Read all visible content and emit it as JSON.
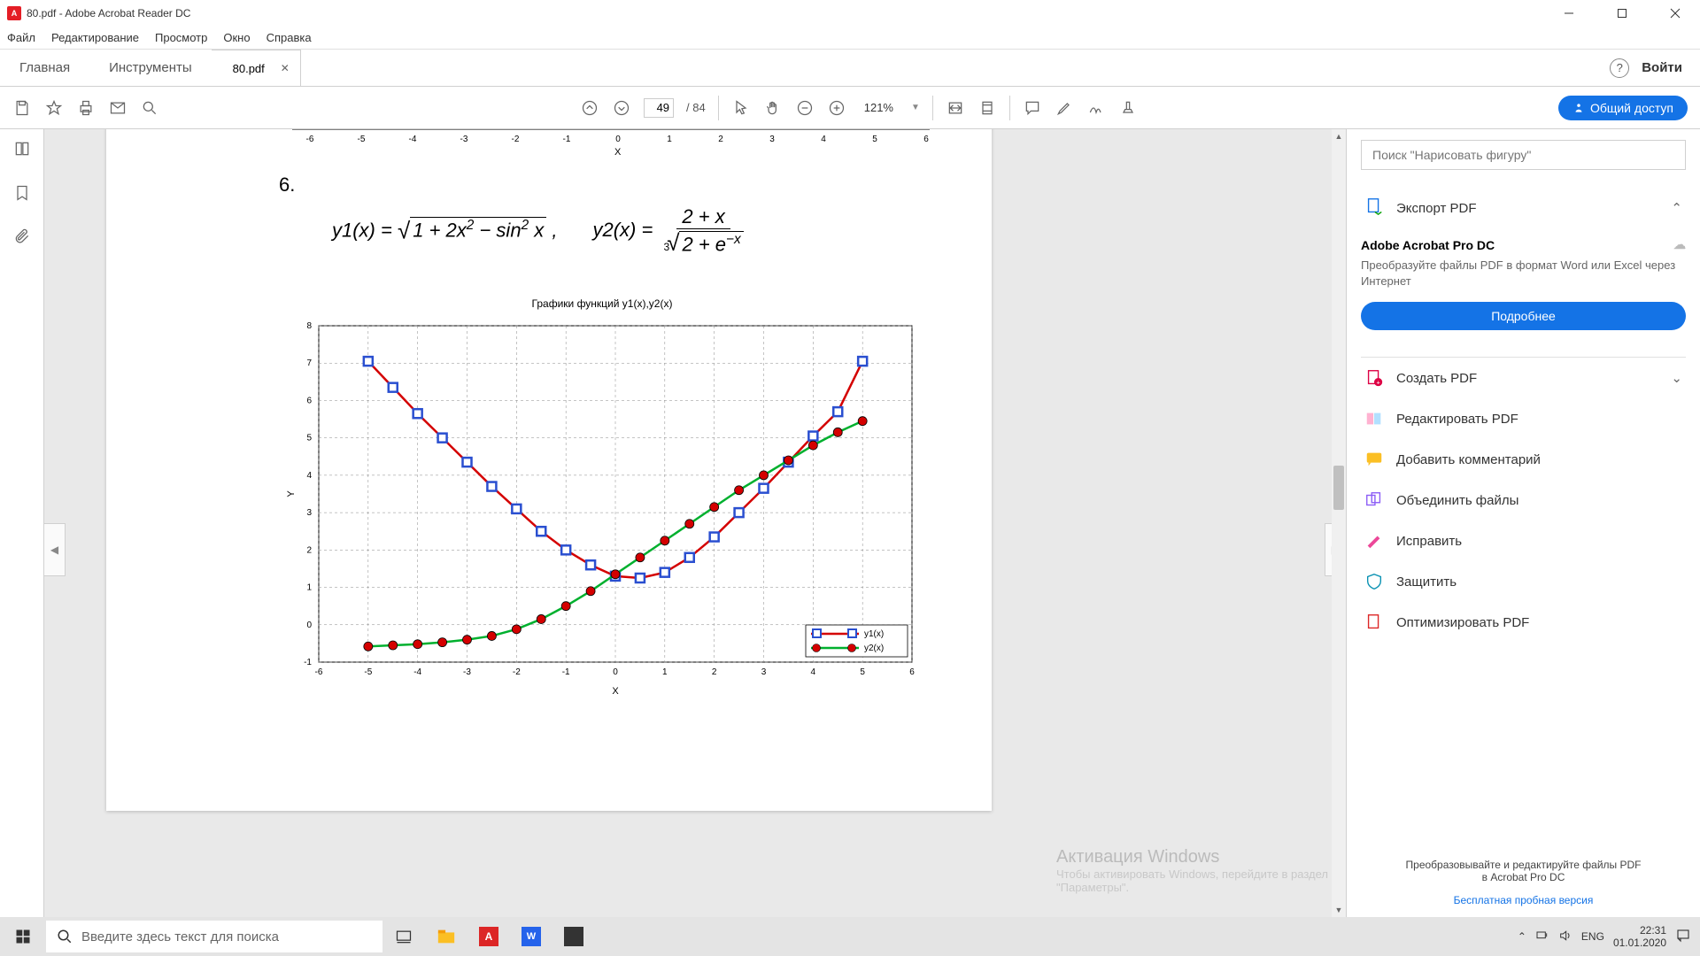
{
  "window": {
    "title": "80.pdf - Adobe Acrobat Reader DC"
  },
  "menu": {
    "file": "Файл",
    "edit": "Редактирование",
    "view": "Просмотр",
    "window": "Окно",
    "help": "Справка"
  },
  "tabs": {
    "home": "Главная",
    "tools": "Инструменты",
    "doc": "80.pdf"
  },
  "auth": {
    "login": "Войти"
  },
  "toolbar": {
    "page_current": "49",
    "page_total": "/ 84",
    "zoom": "121%",
    "share": "Общий доступ"
  },
  "page": {
    "item_num": "6.",
    "eq_text": "y1(x) = √(1 + 2x² − sin² x),   y2(x) = (2 + x) / ∛(2 + e^(−x))",
    "axis_label": "X"
  },
  "chart_data": {
    "type": "line",
    "title": "Графики функций y1(x),y2(x)",
    "xlabel": "X",
    "ylabel": "Y",
    "xlim": [
      -6,
      6
    ],
    "ylim": [
      -1,
      8
    ],
    "x": [
      -5,
      -4.5,
      -4,
      -3.5,
      -3,
      -2.5,
      -2,
      -1.5,
      -1,
      -0.5,
      0,
      0.5,
      1,
      1.5,
      2,
      2.5,
      3,
      3.5,
      4,
      4.5,
      5
    ],
    "series": [
      {
        "name": "y1(x)",
        "color": "#d40000",
        "marker": "square",
        "marker_fill": "#2a4fd0",
        "values": [
          7.05,
          6.35,
          5.65,
          5.0,
          4.35,
          3.7,
          3.1,
          2.5,
          2.0,
          1.6,
          1.3,
          1.25,
          1.4,
          1.8,
          2.35,
          3.0,
          3.65,
          4.35,
          5.05,
          5.7,
          7.05
        ]
      },
      {
        "name": "y2(x)",
        "color": "#00b02e",
        "marker": "circle",
        "marker_fill": "#d40000",
        "values": [
          -0.58,
          -0.55,
          -0.52,
          -0.47,
          -0.4,
          -0.3,
          -0.12,
          0.15,
          0.5,
          0.9,
          1.35,
          1.8,
          2.25,
          2.7,
          3.15,
          3.6,
          4.0,
          4.4,
          4.8,
          5.15,
          5.45
        ]
      }
    ],
    "legend": {
      "position": "lower right",
      "entries": [
        "y1(x)",
        "y2(x)"
      ]
    }
  },
  "right": {
    "search_ph": "Поиск \"Нарисовать фигуру\"",
    "export": "Экспорт PDF",
    "promo_title": "Adobe Acrobat Pro DC",
    "promo_desc": "Преобразуйте файлы PDF в формат Word или Excel через Интернет",
    "more": "Подробнее",
    "create": "Создать PDF",
    "edit": "Редактировать PDF",
    "comment": "Добавить комментарий",
    "combine": "Объединить файлы",
    "fix": "Исправить",
    "protect": "Защитить",
    "optimize": "Оптимизировать PDF",
    "footer1": "Преобразовывайте и редактируйте файлы PDF",
    "footer2": "в Acrobat Pro DC",
    "trial": "Бесплатная пробная версия"
  },
  "watermark": {
    "l1": "Активация Windows",
    "l2": "Чтобы активировать Windows, перейдите в раздел",
    "l3": "\"Параметры\"."
  },
  "taskbar": {
    "search_ph": "Введите здесь текст для поиска",
    "lang": "ENG",
    "time": "22:31",
    "date": "01.01.2020"
  }
}
